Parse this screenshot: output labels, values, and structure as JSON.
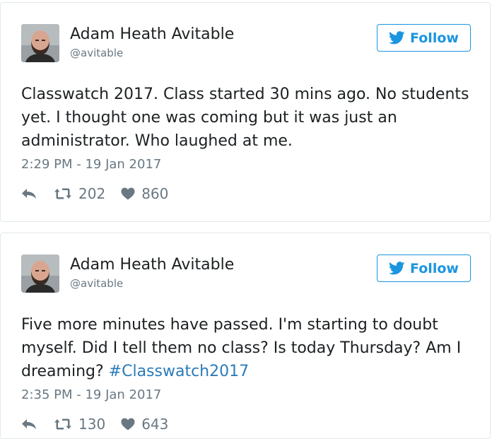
{
  "tweets": [
    {
      "author": {
        "name": "Adam Heath Avitable",
        "handle": "@avitable"
      },
      "follow_label": "Follow",
      "text": "Classwatch 2017. Class started 30 mins ago. No students yet. I thought one was coming but it was just an administrator. Who laughed at me.",
      "hashtag": "",
      "timestamp": "2:29 PM - 19 Jan 2017",
      "retweets": "202",
      "likes": "860"
    },
    {
      "author": {
        "name": "Adam Heath Avitable",
        "handle": "@avitable"
      },
      "follow_label": "Follow",
      "text": "Five more minutes have passed. I'm starting to doubt myself. Did I tell them no class? Is today Thursday? Am I dreaming? ",
      "hashtag": "#Classwatch2017",
      "timestamp": "2:35 PM - 19 Jan 2017",
      "retweets": "130",
      "likes": "643"
    }
  ],
  "icons": {
    "bird": "twitter-bird-icon",
    "reply": "reply-icon",
    "retweet": "retweet-icon",
    "like": "heart-icon"
  },
  "colors": {
    "accent": "#1b95e0",
    "hashtag": "#2b7bb9",
    "text": "#1c2022",
    "muted": "#697882",
    "border": "#e1e8ed"
  }
}
